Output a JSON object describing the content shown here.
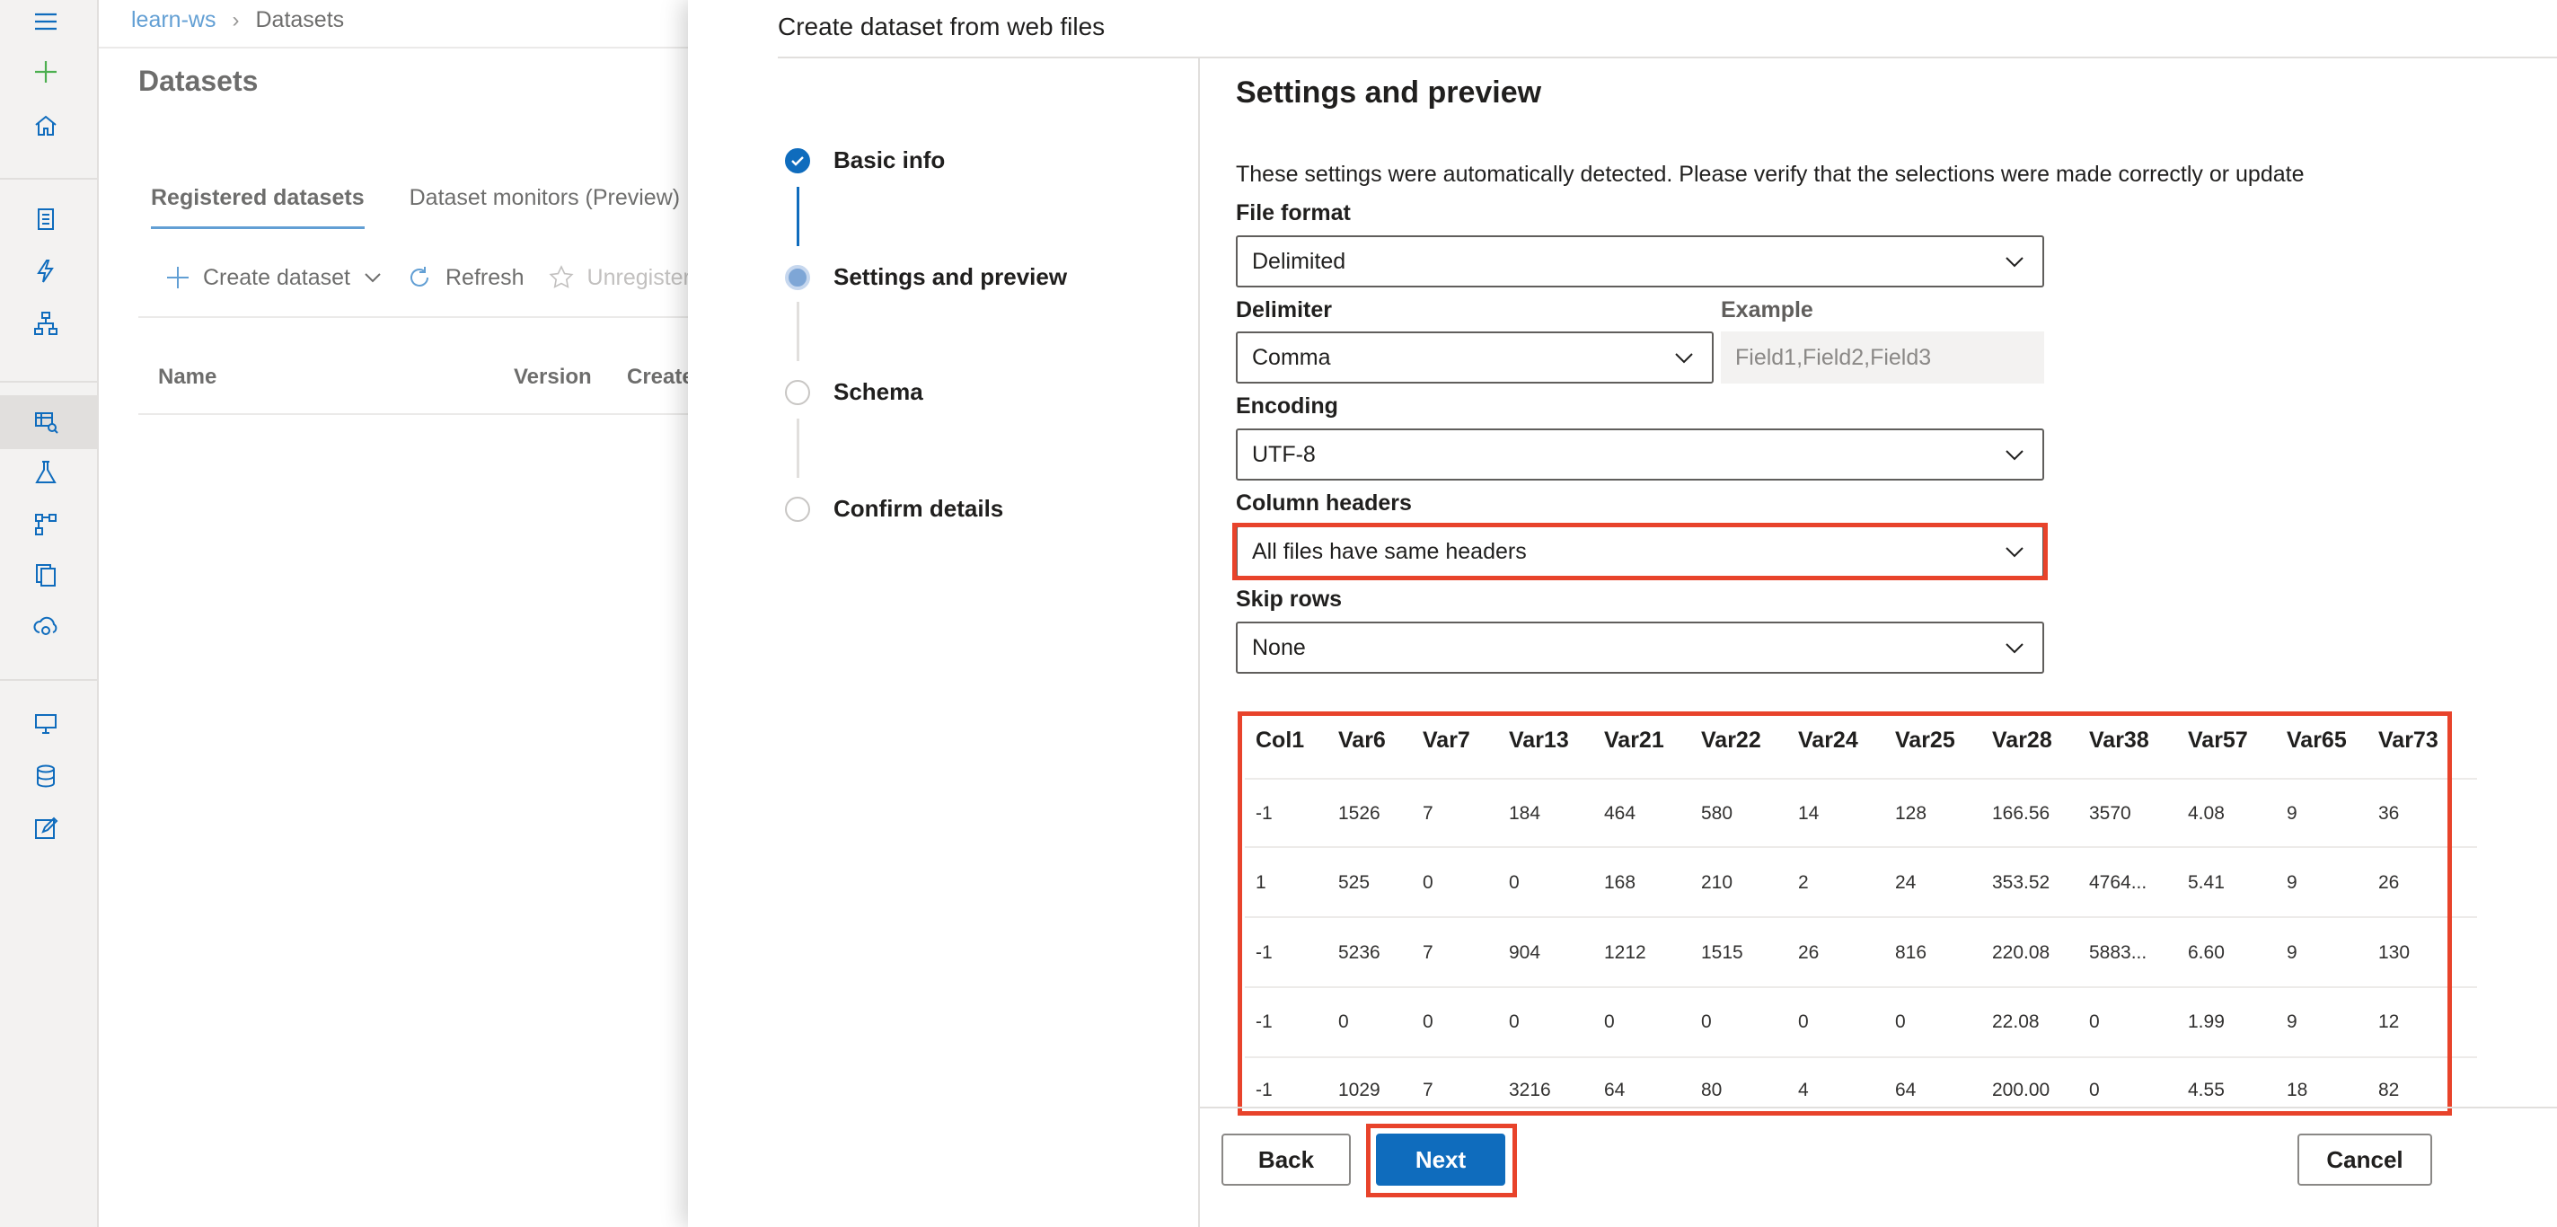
{
  "nav": {
    "items": [
      "menu-icon",
      "create-new-icon",
      "home-icon",
      "notebooks-icon",
      "automated-ml-icon",
      "designer-icon",
      "datasets-icon",
      "experiments-icon",
      "pipelines-icon",
      "models-icon",
      "endpoints-icon",
      "compute-icon",
      "datastores-icon",
      "data-labeling-icon"
    ],
    "accent": "#0f6cbd"
  },
  "breadcrumb": {
    "workspace": "learn-ws",
    "current": "Datasets"
  },
  "page": {
    "title": "Datasets",
    "tabs": [
      "Registered datasets",
      "Dataset monitors (Preview)"
    ],
    "toolbar": {
      "create": "Create dataset",
      "refresh": "Refresh",
      "unregister": "Unregister"
    },
    "columns": [
      "Name",
      "Version",
      "Create"
    ]
  },
  "panel": {
    "title": "Create dataset from web files",
    "steps": [
      "Basic info",
      "Settings and preview",
      "Schema",
      "Confirm details"
    ],
    "section_title": "Settings and preview",
    "description": "These settings were automatically detected. Please verify that the selections were made correctly or update",
    "file_format": {
      "label": "File format",
      "value": "Delimited"
    },
    "delimiter": {
      "label": "Delimiter",
      "value": "Comma"
    },
    "example": {
      "label": "Example",
      "placeholder": "Field1,Field2,Field3"
    },
    "encoding": {
      "label": "Encoding",
      "value": "UTF-8"
    },
    "column_headers": {
      "label": "Column headers",
      "value": "All files have same headers"
    },
    "skip_rows": {
      "label": "Skip rows",
      "value": "None"
    },
    "highlight_color": "#e8432b"
  },
  "preview": {
    "headers": [
      "Col1",
      "Var6",
      "Var7",
      "Var13",
      "Var21",
      "Var22",
      "Var24",
      "Var25",
      "Var28",
      "Var38",
      "Var57",
      "Var65",
      "Var73"
    ],
    "rows": [
      [
        "-1",
        "1526",
        "7",
        "184",
        "464",
        "580",
        "14",
        "128",
        "166.56",
        "3570",
        "4.08",
        "9",
        "36"
      ],
      [
        "1",
        "525",
        "0",
        "0",
        "168",
        "210",
        "2",
        "24",
        "353.52",
        "4764...",
        "5.41",
        "9",
        "26"
      ],
      [
        "-1",
        "5236",
        "7",
        "904",
        "1212",
        "1515",
        "26",
        "816",
        "220.08",
        "5883...",
        "6.60",
        "9",
        "130"
      ],
      [
        "-1",
        "0",
        "0",
        "0",
        "0",
        "0",
        "0",
        "0",
        "22.08",
        "0",
        "1.99",
        "9",
        "12"
      ],
      [
        "-1",
        "1029",
        "7",
        "3216",
        "64",
        "80",
        "4",
        "64",
        "200.00",
        "0",
        "4.55",
        "18",
        "82"
      ]
    ]
  },
  "footer": {
    "back": "Back",
    "next": "Next",
    "cancel": "Cancel"
  }
}
